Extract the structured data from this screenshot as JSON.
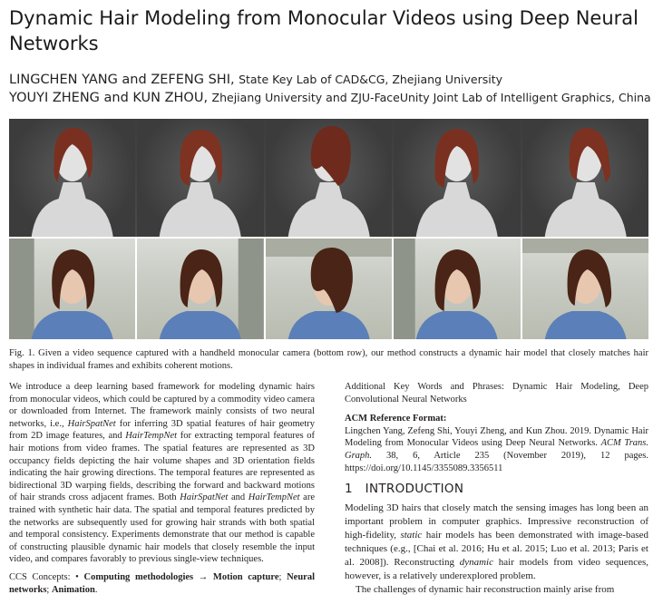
{
  "title": "Dynamic Hair Modeling from Monocular Videos using Deep Neural Networks",
  "authors": [
    {
      "names": "LINGCHEN YANG and ZEFENG SHI,",
      "affiliation": "State Key Lab of CAD&CG, Zhejiang University"
    },
    {
      "names": "YOUYI ZHENG and KUN ZHOU,",
      "affiliation": "Zhejiang University and ZJU-FaceUnity Joint Lab of Intelligent Graphics, China"
    }
  ],
  "figure": {
    "top_row_count": 5,
    "bottom_row_count": 5,
    "caption_label": "Fig. 1.",
    "caption": "Given a video sequence captured with a handheld monocular camera (bottom row), our method constructs a dynamic hair model that closely matches hair shapes in individual frames and exhibits coherent motions."
  },
  "abstract": {
    "s1": "We introduce a deep learning based framework for modeling dynamic hairs from monocular videos, which could be captured by a commodity video camera or downloaded from Internet. The framework mainly consists of two neural networks, i.e., ",
    "net1": "HairSpatNet",
    "s2": " for inferring 3D spatial features of hair geometry from 2D image features, and ",
    "net2": "HairTempNet",
    "s3": " for extracting temporal features of hair motions from video frames. The spatial features are represented as 3D occupancy fields depicting the hair volume shapes and 3D orientation fields indicating the hair growing directions. The temporal features are represented as bidirectional 3D warping fields, describing the forward and backward motions of hair strands cross adjacent frames. Both ",
    "net3": "HairSpatNet",
    "s4": " and ",
    "net4": "HairTempNet",
    "s5": " are trained with synthetic hair data. The spatial and temporal features predicted by the networks are subsequently used for growing hair strands with both spatial and temporal consistency. Experiments demonstrate that our method is capable of constructing plausible dynamic hair models that closely resemble the input video, and compares favorably to previous single-view techniques."
  },
  "ccs": {
    "label": "CCS Concepts: • ",
    "c1": "Computing methodologies → Motion capture",
    "sep1": "; ",
    "c2": "Neural networks",
    "sep2": "; ",
    "c3": "Animation",
    "end": "."
  },
  "keywords": "Additional Key Words and Phrases: Dynamic Hair Modeling, Deep Convolutional Neural Networks",
  "reference": {
    "heading": "ACM Reference Format:",
    "t1": "Lingchen Yang, Zefeng Shi, Youyi Zheng, and Kun Zhou. 2019. Dynamic Hair Modeling from Monocular Videos using Deep Neural Networks. ",
    "journal": "ACM Trans. Graph.",
    "t2": " 38, 6, Article 235 (November 2019), 12 pages. https://doi.org/10.1145/3355089.3356511"
  },
  "intro": {
    "number": "1",
    "heading": "INTRODUCTION",
    "p1a": "Modeling 3D hairs that closely match the sensing images has long been an important problem in computer graphics. Impressive reconstruction of high-fidelity, ",
    "p1b": "static",
    "p1c": " hair models has been demonstrated with image-based techniques (e.g., [Chai et al. 2016; Hu et al. 2015; Luo et al. 2013; Paris et al. 2008]). Reconstructing ",
    "p1d": "dynamic",
    "p1e": " hair models from video sequences, however, is a relatively underexplored problem.",
    "p2": "The challenges of dynamic hair reconstruction mainly arise from"
  }
}
